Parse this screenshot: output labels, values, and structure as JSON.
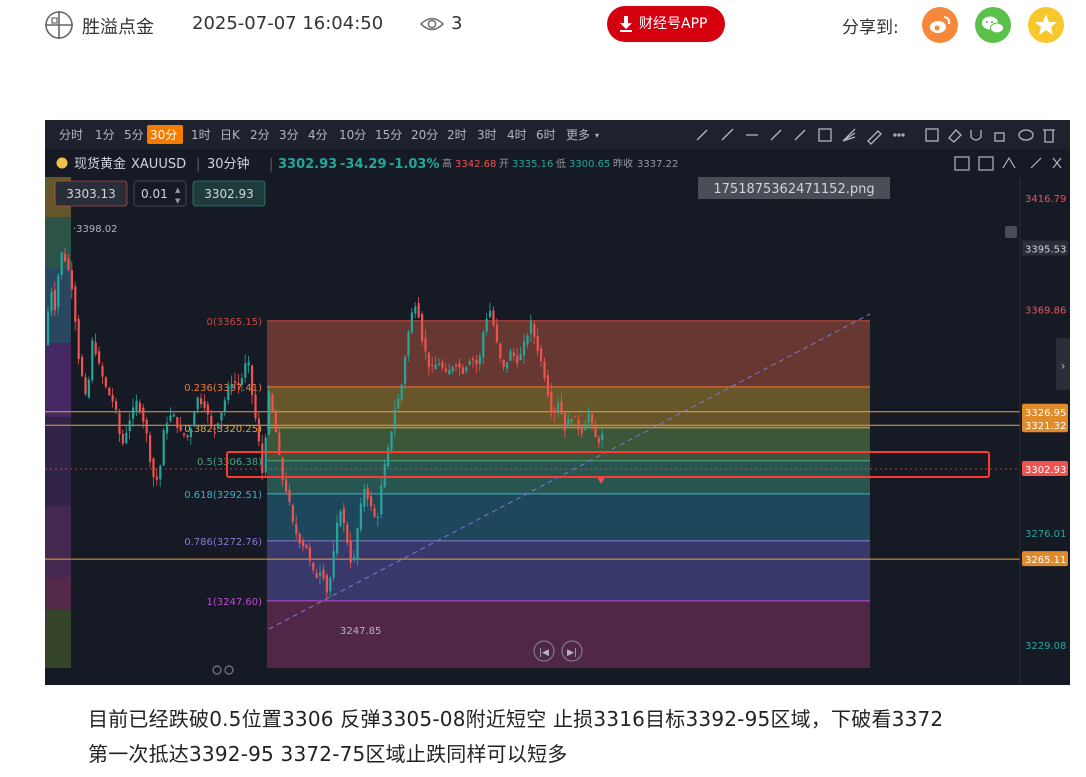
{
  "header": {
    "author": "胜溢点金",
    "datetime": "2025-07-07 16:04:50",
    "views": "3",
    "app_button": "财经号APP",
    "share_label": "分享到:",
    "share_icons": [
      "weibo-icon",
      "wechat-icon",
      "qzone-icon"
    ]
  },
  "toolbar": {
    "timeframes": [
      "分时",
      "1分",
      "5分",
      "30分",
      "1时",
      "日K",
      "2分",
      "3分",
      "4分",
      "10分",
      "15分",
      "20分",
      "2时",
      "3时",
      "4时",
      "6时",
      "更多"
    ],
    "active": "30分"
  },
  "symbol_bar": {
    "name": "现货黄金",
    "code": "XAUUSD",
    "period": "30分钟",
    "last": "3302.93",
    "change": "-34.29",
    "change_pct": "-1.03%",
    "high_label": "高",
    "high": "3342.68",
    "open_label": "开",
    "open": "3335.16",
    "low_label": "低",
    "low": "3300.65",
    "prev_label": "昨收",
    "prev": "3337.22"
  },
  "order_panel": {
    "sell": "3303.13",
    "qty": "0.01",
    "buy": "3302.93"
  },
  "image_label": "1751875362471152.png",
  "fib_labels": [
    "0(3365.15)",
    "0.236(3337.41)",
    "0.382(3320.25)",
    "0.5(3306.38)",
    "0.618(3292.51)",
    "0.786(3272.76)",
    "1(3247.60)"
  ],
  "price_axis": [
    "3416.79",
    "3395.53",
    "3369.86",
    "3326.95",
    "3321.32",
    "3302.93",
    "3276.01",
    "3265.11",
    "3229.08"
  ],
  "extremes": {
    "high": "3398.02",
    "low": "3247.85"
  },
  "annotation": {
    "line1": "目前已经跌破0.5位置3306 反弹3305-08附近短空  止损3316目标3392-95区域，下破看3372",
    "line2": "第一次抵达3392-95 3372-75区域止跌同样可以短多"
  },
  "colors": {
    "app_button": "#d4000f",
    "weibo": "#f5883a",
    "wechat": "#5cc14a",
    "qzone": "#f7c72b",
    "up": "#26a69a",
    "down": "#ef5350",
    "highlight_box": "#ff3b30"
  }
}
